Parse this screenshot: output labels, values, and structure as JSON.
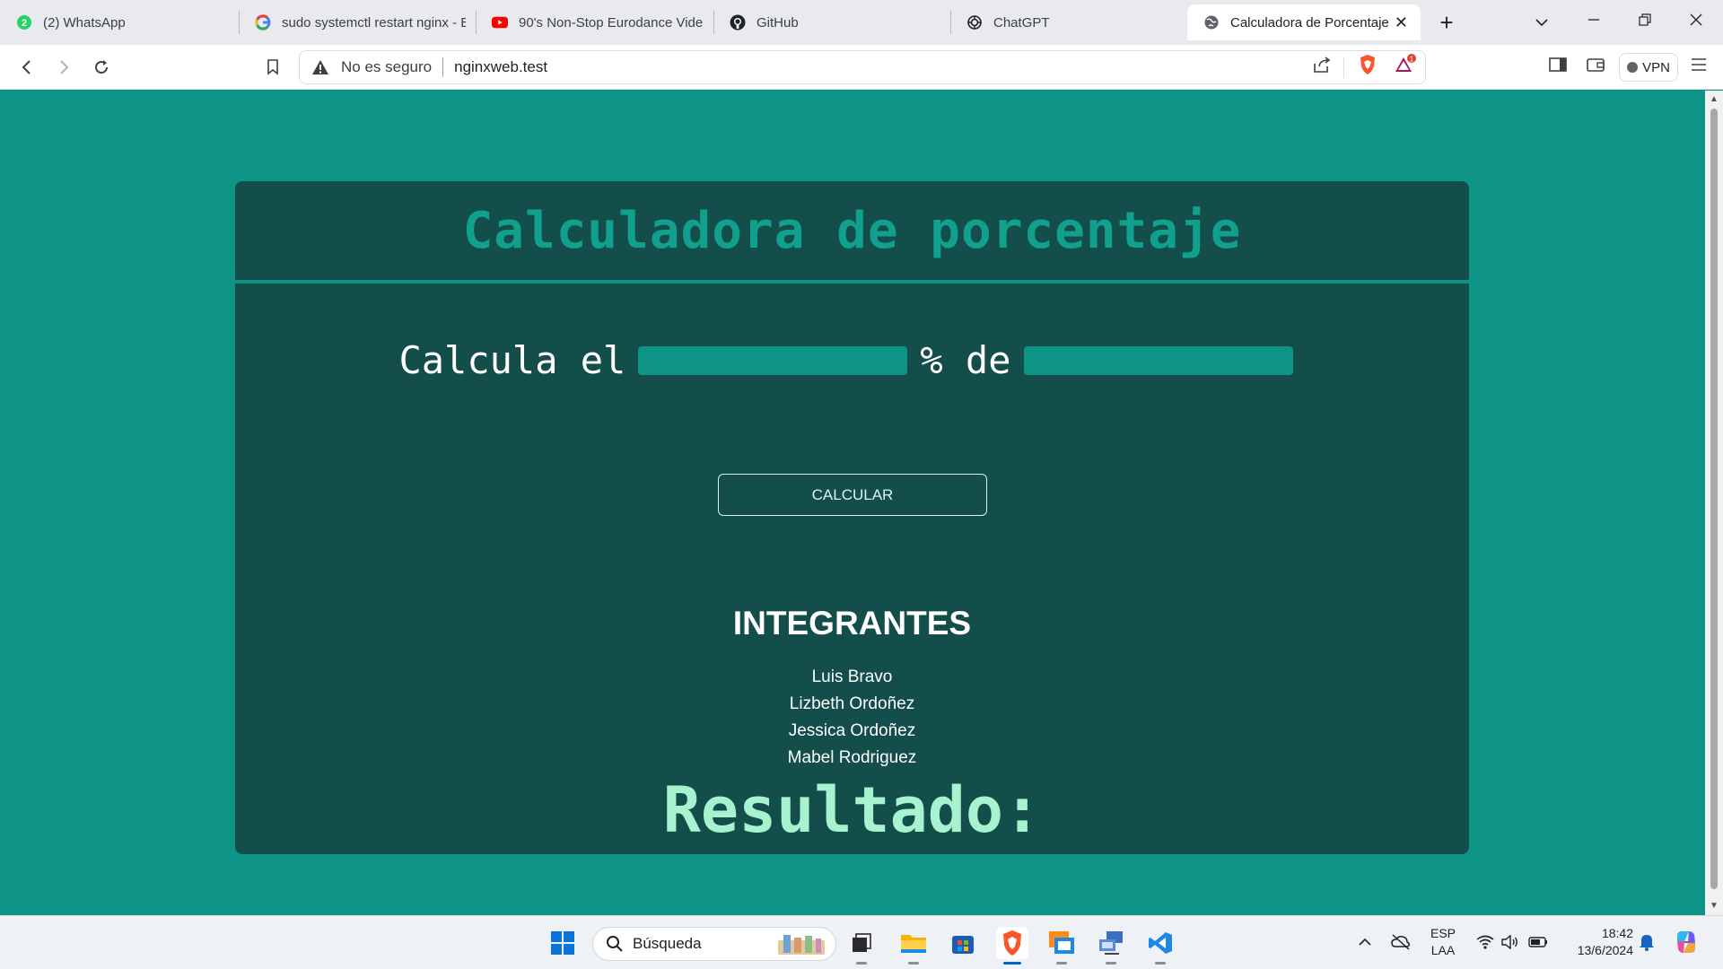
{
  "browser": {
    "tabs": [
      {
        "title": "(2) WhatsApp",
        "icon": "whatsapp-icon",
        "active": false
      },
      {
        "title": "sudo systemctl restart nginx - B",
        "icon": "google-icon",
        "active": false
      },
      {
        "title": "90's Non-Stop Eurodance Vide",
        "icon": "youtube-icon",
        "active": false
      },
      {
        "title": "GitHub",
        "icon": "github-icon",
        "active": false
      },
      {
        "title": "ChatGPT",
        "icon": "chatgpt-icon",
        "active": false
      },
      {
        "title": "Calculadora de Porcentaje",
        "icon": "globe-icon",
        "active": true
      }
    ],
    "new_tab_label": "+",
    "whatsapp_badge": "2",
    "security_text": "No es seguro",
    "url": "nginxweb.test",
    "vpn_label": "VPN",
    "brave_rewards_badge": "1",
    "colors": {
      "brave": "#fb542b",
      "vpn_dot": "#5f6368"
    }
  },
  "page": {
    "title": "Calculadora de porcentaje",
    "calc_prefix": "Calcula el",
    "calc_middle": "% de",
    "input_percent_value": "",
    "input_base_value": "",
    "calculate_button": "CALCULAR",
    "members_title": "INTEGRANTES",
    "members": [
      "Luis Bravo",
      "Lizbeth Ordoñez",
      "Jessica Ordoñez",
      "Mabel Rodriguez"
    ],
    "result_label": "Resultado:",
    "colors": {
      "background": "#0e9486",
      "card": "#134e4a",
      "title": "#10a08d",
      "result": "#a7f3d0"
    }
  },
  "taskbar": {
    "search_placeholder": "Búsqueda",
    "language": "ESP",
    "layout": "LAA",
    "time": "18:42",
    "date": "13/6/2024",
    "pinned": [
      "start-icon",
      "file-explorer-icon",
      "folder-icon",
      "store-icon",
      "brave-icon",
      "remote-desktop-icon",
      "network-app-icon",
      "vscode-icon"
    ]
  }
}
